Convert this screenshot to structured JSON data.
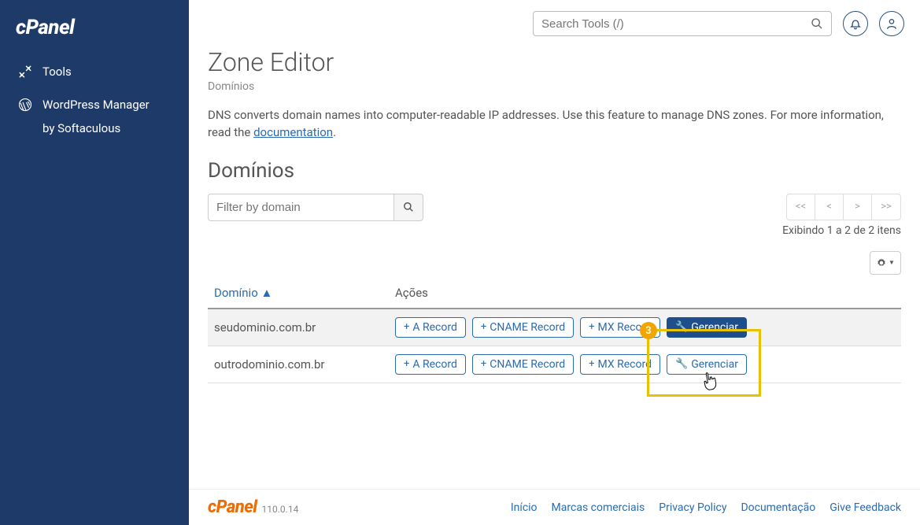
{
  "brand": "cPanel",
  "sidebar": {
    "items": [
      {
        "label": "Tools"
      },
      {
        "label1": "WordPress Manager",
        "label2": "by Softaculous"
      }
    ]
  },
  "topbar": {
    "search_placeholder": "Search Tools (/)"
  },
  "page": {
    "title": "Zone Editor",
    "breadcrumb": "Domínios",
    "description_1": "DNS converts domain names into computer-readable IP addresses. Use this feature to manage DNS zones. For more information, read the ",
    "doc_link": "documentation",
    "description_2": "."
  },
  "section": {
    "heading": "Domínios",
    "filter_placeholder": "Filter by domain",
    "pager": {
      "first": "<<",
      "prev": "<",
      "next": ">",
      "last": ">>"
    },
    "results_text": "Exibindo 1 a 2 de 2 itens"
  },
  "table": {
    "col_domain": "Domínio",
    "col_actions": "Ações",
    "rows": [
      {
        "domain": "seudominio.com.br"
      },
      {
        "domain": "outrodominio.com.br"
      }
    ],
    "btn_a": "A Record",
    "btn_cname": "CNAME Record",
    "btn_mx": "MX Record",
    "btn_manage": "Gerenciar"
  },
  "annotation": {
    "number": "3"
  },
  "footer": {
    "brand": "cPanel",
    "version": "110.0.14",
    "links": {
      "home": "Início",
      "trademarks": "Marcas comerciais",
      "privacy": "Privacy Policy",
      "docs": "Documentação",
      "feedback": "Give Feedback"
    }
  }
}
